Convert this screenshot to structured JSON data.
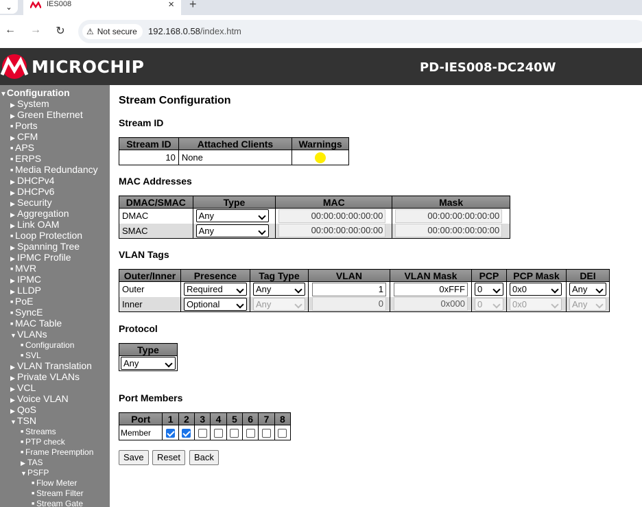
{
  "browser": {
    "tab_title": "IES008",
    "url_host": "192.168.0.58",
    "url_path": "/index.htm",
    "security_label": "Not secure"
  },
  "header": {
    "brand": "MICROCHIP",
    "model": "PD-IES008-DC240W"
  },
  "sidebar": {
    "root": "Configuration",
    "items": [
      {
        "label": "System",
        "mark": "▶",
        "level": 1
      },
      {
        "label": "Green Ethernet",
        "mark": "▶",
        "level": 1
      },
      {
        "label": "Ports",
        "mark": "■",
        "level": 1
      },
      {
        "label": "CFM",
        "mark": "▶",
        "level": 1
      },
      {
        "label": "APS",
        "mark": "■",
        "level": 1
      },
      {
        "label": "ERPS",
        "mark": "■",
        "level": 1
      },
      {
        "label": "Media Redundancy",
        "mark": "■",
        "level": 1
      },
      {
        "label": "DHCPv4",
        "mark": "▶",
        "level": 1
      },
      {
        "label": "DHCPv6",
        "mark": "▶",
        "level": 1
      },
      {
        "label": "Security",
        "mark": "▶",
        "level": 1
      },
      {
        "label": "Aggregation",
        "mark": "▶",
        "level": 1
      },
      {
        "label": "Link OAM",
        "mark": "▶",
        "level": 1
      },
      {
        "label": "Loop Protection",
        "mark": "■",
        "level": 1
      },
      {
        "label": "Spanning Tree",
        "mark": "▶",
        "level": 1
      },
      {
        "label": "IPMC Profile",
        "mark": "▶",
        "level": 1
      },
      {
        "label": "MVR",
        "mark": "■",
        "level": 1
      },
      {
        "label": "IPMC",
        "mark": "▶",
        "level": 1
      },
      {
        "label": "LLDP",
        "mark": "▶",
        "level": 1
      },
      {
        "label": "PoE",
        "mark": "■",
        "level": 1
      },
      {
        "label": "SyncE",
        "mark": "■",
        "level": 1
      },
      {
        "label": "MAC Table",
        "mark": "■",
        "level": 1
      },
      {
        "label": "VLANs",
        "mark": "▼",
        "level": 1
      },
      {
        "label": "Configuration",
        "mark": "■",
        "level": 2
      },
      {
        "label": "SVL",
        "mark": "■",
        "level": 2
      },
      {
        "label": "VLAN Translation",
        "mark": "▶",
        "level": 1
      },
      {
        "label": "Private VLANs",
        "mark": "▶",
        "level": 1
      },
      {
        "label": "VCL",
        "mark": "▶",
        "level": 1
      },
      {
        "label": "Voice VLAN",
        "mark": "▶",
        "level": 1
      },
      {
        "label": "QoS",
        "mark": "▶",
        "level": 1
      },
      {
        "label": "TSN",
        "mark": "▼",
        "level": 1
      },
      {
        "label": "Streams",
        "mark": "■",
        "level": 2
      },
      {
        "label": "PTP check",
        "mark": "■",
        "level": 2
      },
      {
        "label": "Frame Preemption",
        "mark": "■",
        "level": 2
      },
      {
        "label": "TAS",
        "mark": "▶",
        "level": 2
      },
      {
        "label": "PSFP",
        "mark": "▼",
        "level": 2
      },
      {
        "label": "Flow Meter",
        "mark": "■",
        "level": 3
      },
      {
        "label": "Stream Filter",
        "mark": "■",
        "level": 3
      },
      {
        "label": "Stream Gate",
        "mark": "■",
        "level": 3
      }
    ]
  },
  "page": {
    "title": "Stream Configuration",
    "stream_id_heading": "Stream ID",
    "stream_id_table": {
      "headers": [
        "Stream ID",
        "Attached Clients",
        "Warnings"
      ],
      "stream_id": "10",
      "clients": "None"
    },
    "mac_heading": "MAC Addresses",
    "mac_table": {
      "headers": [
        "DMAC/SMAC",
        "Type",
        "MAC",
        "Mask"
      ],
      "rows": [
        {
          "name": "DMAC",
          "type": "Any",
          "mac": "00:00:00:00:00:00",
          "mask": "00:00:00:00:00:00"
        },
        {
          "name": "SMAC",
          "type": "Any",
          "mac": "00:00:00:00:00:00",
          "mask": "00:00:00:00:00:00"
        }
      ]
    },
    "vlan_heading": "VLAN Tags",
    "vlan_table": {
      "headers": [
        "Outer/Inner",
        "Presence",
        "Tag Type",
        "VLAN",
        "VLAN Mask",
        "PCP",
        "PCP Mask",
        "DEI"
      ],
      "rows": [
        {
          "name": "Outer",
          "presence": "Required",
          "tag_type": "Any",
          "vlan": "1",
          "vlan_mask": "0xFFF",
          "pcp": "0",
          "pcp_mask": "0x0",
          "dei": "Any"
        },
        {
          "name": "Inner",
          "presence": "Optional",
          "tag_type": "Any",
          "vlan": "0",
          "vlan_mask": "0x000",
          "pcp": "0",
          "pcp_mask": "0x0",
          "dei": "Any"
        }
      ]
    },
    "protocol_heading": "Protocol",
    "protocol_table": {
      "header": "Type",
      "value": "Any"
    },
    "ports_heading": "Port Members",
    "ports_table": {
      "header": "Port",
      "row_label": "Member",
      "ports": [
        "1",
        "2",
        "3",
        "4",
        "5",
        "6",
        "7",
        "8"
      ],
      "checked": [
        true,
        true,
        false,
        false,
        false,
        false,
        false,
        false
      ]
    },
    "buttons": {
      "save": "Save",
      "reset": "Reset",
      "back": "Back"
    }
  },
  "colors": {
    "header_bg": "#333333",
    "sidebar_bg": "#808080",
    "table_header": "#808080",
    "warning_dot": "#ffee00",
    "brand_red": "#e4002b"
  }
}
